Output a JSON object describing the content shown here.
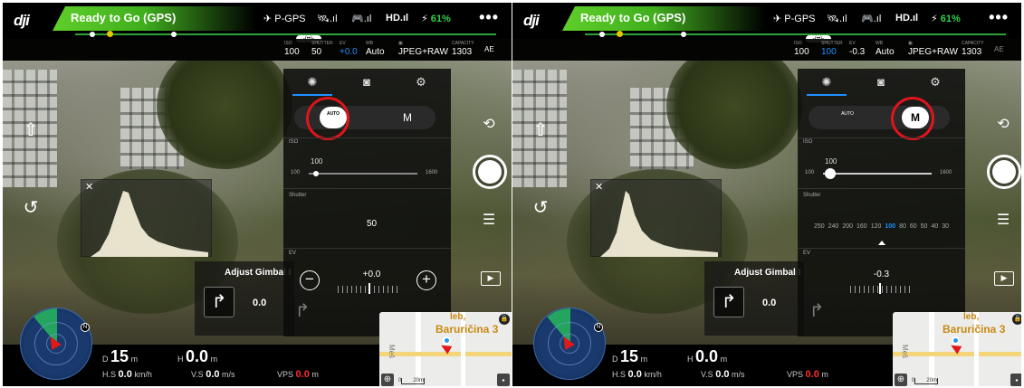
{
  "brand": "dji",
  "status": "Ready to Go (GPS)",
  "top": {
    "flight_mode": "P-GPS",
    "hd_label": "HD",
    "battery": "61%",
    "more": "•••",
    "gps_badge": "-(••)-"
  },
  "params_left": {
    "iso_label": "ISO",
    "iso": "100",
    "shutter_label": "SHUTTER",
    "shutter": "50",
    "ev_label": "EV",
    "ev": "+0.0",
    "wb_label": "WB",
    "wb": "Auto",
    "format": "JPEG+RAW",
    "capacity_label": "CAPACITY",
    "capacity": "1303",
    "ae": "AE"
  },
  "params_right": {
    "iso_label": "ISO",
    "iso": "100",
    "shutter_label": "SHUTTER",
    "shutter": "100",
    "ev_label": "EV",
    "ev": "-0.3",
    "wb_label": "WB",
    "wb": "Auto",
    "format": "JPEG+RAW",
    "capacity_label": "CAPACITY",
    "capacity": "1303",
    "ae": "AE"
  },
  "panel_left": {
    "mode_auto_label": "AUTO",
    "mode_manual_label": "M",
    "selected_mode": "AUTO",
    "iso_section": "ISO",
    "iso_value": "100",
    "iso_min": "100",
    "iso_max": "1600",
    "shutter_section": "Shutter",
    "shutter_value": "50",
    "ev_section": "EV",
    "ev_value": "+0.0",
    "ev_minus": "−",
    "ev_plus": "+"
  },
  "panel_right": {
    "mode_auto_label": "AUTO",
    "mode_manual_label": "M",
    "selected_mode": "M",
    "iso_section": "ISO",
    "iso_value": "100",
    "iso_min": "100",
    "iso_max": "1600",
    "shutter_section": "Shutter",
    "shutter_options": [
      "250",
      "240",
      "200",
      "160",
      "120",
      "100",
      "80",
      "60",
      "50",
      "40",
      "30"
    ],
    "shutter_selected": "100",
    "ev_section": "EV",
    "ev_value": "-0.3"
  },
  "gimbal": {
    "title": "Adjust Gimbal I",
    "value": "0.0"
  },
  "telemetry": {
    "d_label": "D",
    "d_value": "15",
    "d_unit": "m",
    "h_label": "H",
    "h_value": "0.0",
    "h_unit": "m",
    "hs_label": "H.S",
    "hs_value": "0.0",
    "hs_unit": "km/h",
    "vs_label": "V.S",
    "vs_value": "0.0",
    "vs_unit": "m/s",
    "vps_label": "VPS",
    "vps_value": "0.0",
    "vps_unit": "m"
  },
  "map": {
    "street_top": "leb,",
    "street": "Baruričina 3",
    "street_side": "Meš",
    "scale": "20m",
    "scale_zero": "0",
    "zoom_icon": "⊕"
  },
  "radar": {
    "north": "N"
  },
  "colors": {
    "accent_blue": "#1e90ff",
    "status_green": "#3fae1d",
    "battery_green": "#33d04a",
    "highlight_red": "#e0141c",
    "warn_red": "#ff2b2b"
  },
  "icons": [
    "dji-logo",
    "drone-icon",
    "satellite-icon",
    "remote-signal-icon",
    "hd-signal-icon",
    "battery-icon",
    "more-icon",
    "takeoff-icon",
    "return-home-icon",
    "camera-switch-icon",
    "shutter-button",
    "settings-sliders-icon",
    "playback-icon",
    "aperture-tab-icon",
    "camera-tab-icon",
    "gear-tab-icon",
    "gimbal-icon",
    "close-icon",
    "lock-icon",
    "eraser-icon",
    "zoom-icon"
  ]
}
